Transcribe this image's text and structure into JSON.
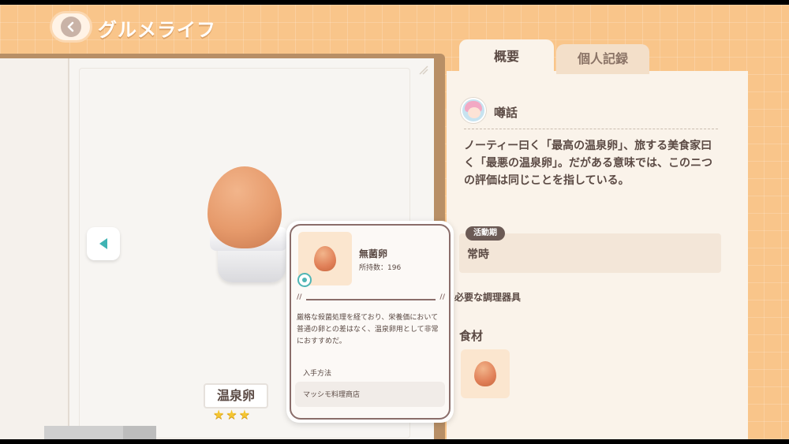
{
  "header": {
    "title": "グルメライフ"
  },
  "dish": {
    "name": "温泉卵",
    "stars": "★★★",
    "rating": 3
  },
  "tabs": [
    {
      "label": "概要",
      "active": true
    },
    {
      "label": "個人記録",
      "active": false
    }
  ],
  "rumor": {
    "title": "噂話",
    "text": "ノーティー曰く「最高の温泉卵」、旅する美食家曰く「最悪の温泉卵」。だがある意味では、このニつの評価は同じことを指している。"
  },
  "active_period": {
    "label": "活動期",
    "value": "常時"
  },
  "tools": {
    "label": "必要な調理器具"
  },
  "ingredients": {
    "label": "食材",
    "items": [
      {
        "icon": "egg-icon"
      }
    ]
  },
  "popup": {
    "name": "無菌卵",
    "count": "所持数：196",
    "divider": "//",
    "description": "厳格な殺菌処理を経ており、栄養価において普通の卵との差はなく、温泉卵用として非常におすすめだ。",
    "acquire_label": "入手方法",
    "acquire_value": "マッシモ料理商店"
  },
  "colors": {
    "background": "#f9c58a",
    "panel": "#faf3ea",
    "text": "#5b4a44",
    "accent_teal": "#4fb5b5",
    "star": "#f4c531"
  }
}
